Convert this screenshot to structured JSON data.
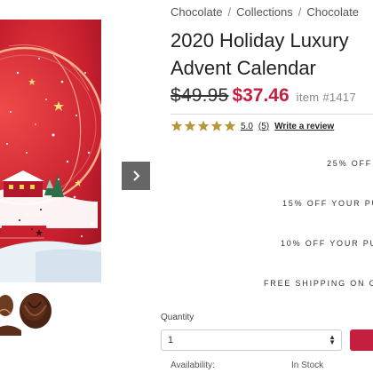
{
  "breadcrumb": [
    "Chocolate",
    "Collections",
    "Chocolate"
  ],
  "product": {
    "title_line1": "2020 Holiday Luxury",
    "title_line2": "Advent Calendar",
    "old_price": "$49.95",
    "sale_price": "$37.46",
    "item_number": "item #1417"
  },
  "rating": {
    "value": "5.0",
    "stars": 5,
    "review_count": "(5)",
    "write_review": "Write a review"
  },
  "promos": [
    "25% OFF",
    "15% OFF YOUR PU",
    "10% OFF YOUR PU",
    "FREE SHIPPING ON O"
  ],
  "purchase": {
    "quantity_label": "Quantity",
    "quantity_value": "1"
  },
  "availability": {
    "label": "Availability:",
    "value": "In Stock"
  },
  "icons": {
    "next": "chevron-right-icon",
    "star": "star-icon",
    "select": "updown-arrows-icon"
  },
  "colors": {
    "accent": "#c41f3e",
    "star": "#b8963c",
    "calendar_red": "#c8202f"
  }
}
